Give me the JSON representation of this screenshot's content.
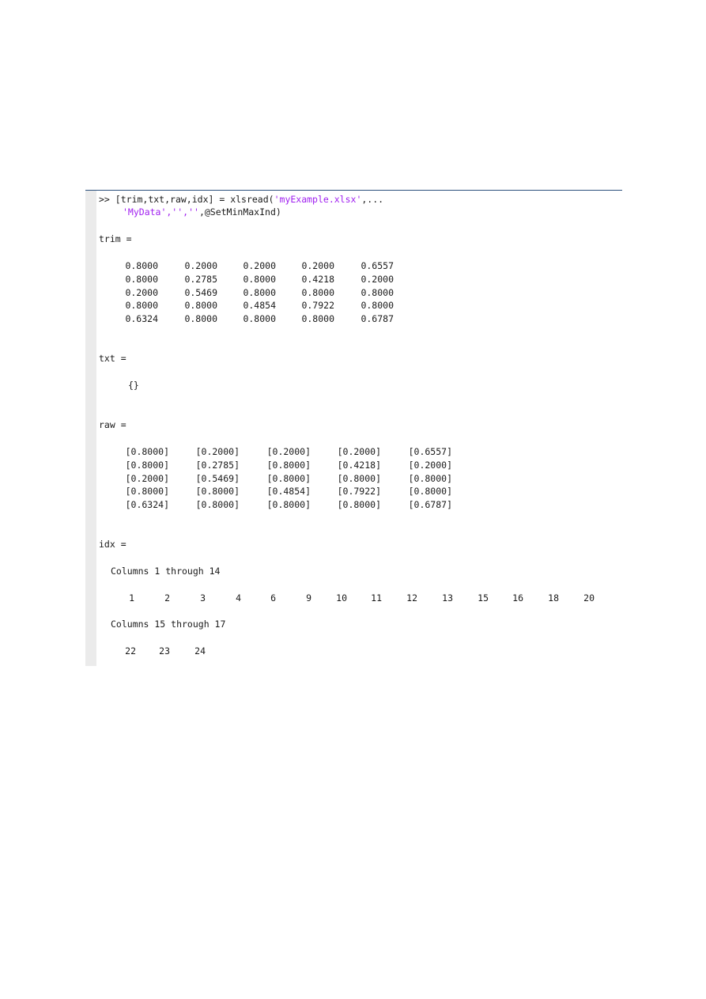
{
  "command": {
    "prompt": ">>",
    "line1_code": "[trim,txt,raw,idx] = xlsread(",
    "line1_string": "'myExample.xlsx'",
    "line1_tail": ",...",
    "line2_string": "'MyData','',''",
    "line2_tail": ",@SetMinMaxInd)"
  },
  "trim": {
    "label": "trim =",
    "rows": [
      [
        "0.8000",
        "0.2000",
        "0.2000",
        "0.2000",
        "0.6557"
      ],
      [
        "0.8000",
        "0.2785",
        "0.8000",
        "0.4218",
        "0.2000"
      ],
      [
        "0.2000",
        "0.5469",
        "0.8000",
        "0.8000",
        "0.8000"
      ],
      [
        "0.8000",
        "0.8000",
        "0.4854",
        "0.7922",
        "0.8000"
      ],
      [
        "0.6324",
        "0.8000",
        "0.8000",
        "0.8000",
        "0.6787"
      ]
    ]
  },
  "txt": {
    "label": "txt =",
    "value": "{}"
  },
  "raw": {
    "label": "raw =",
    "rows": [
      [
        "[0.8000]",
        "[0.2000]",
        "[0.2000]",
        "[0.2000]",
        "[0.6557]"
      ],
      [
        "[0.8000]",
        "[0.2785]",
        "[0.8000]",
        "[0.4218]",
        "[0.2000]"
      ],
      [
        "[0.2000]",
        "[0.5469]",
        "[0.8000]",
        "[0.8000]",
        "[0.8000]"
      ],
      [
        "[0.8000]",
        "[0.8000]",
        "[0.4854]",
        "[0.7922]",
        "[0.8000]"
      ],
      [
        "[0.6324]",
        "[0.8000]",
        "[0.8000]",
        "[0.8000]",
        "[0.6787]"
      ]
    ]
  },
  "idx": {
    "label": "idx =",
    "header1": "Columns 1 through 14",
    "values1": [
      "1",
      "2",
      "3",
      "4",
      "6",
      "9",
      "10",
      "11",
      "12",
      "13",
      "15",
      "16",
      "18",
      "20"
    ],
    "header2": "Columns 15 through 17",
    "values2": [
      "22",
      "23",
      "24"
    ]
  }
}
